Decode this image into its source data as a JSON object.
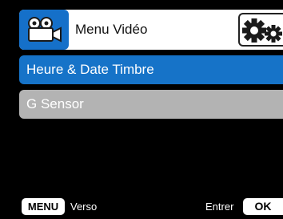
{
  "header": {
    "mode_icon": "video-camera-icon",
    "title": "Menu Vidéo",
    "settings_icon": "gear-icon"
  },
  "menu": {
    "items": [
      {
        "label": "Heure & Date Timbre",
        "selected": true
      },
      {
        "label": "G Sensor",
        "selected": false
      }
    ]
  },
  "footer": {
    "menu_key": "MENU",
    "back_label": "Verso",
    "enter_label": "Entrer",
    "ok_key": "OK"
  },
  "colors": {
    "accent": "#1673c8",
    "unselected": "#b3b3b3",
    "background": "#000000"
  }
}
